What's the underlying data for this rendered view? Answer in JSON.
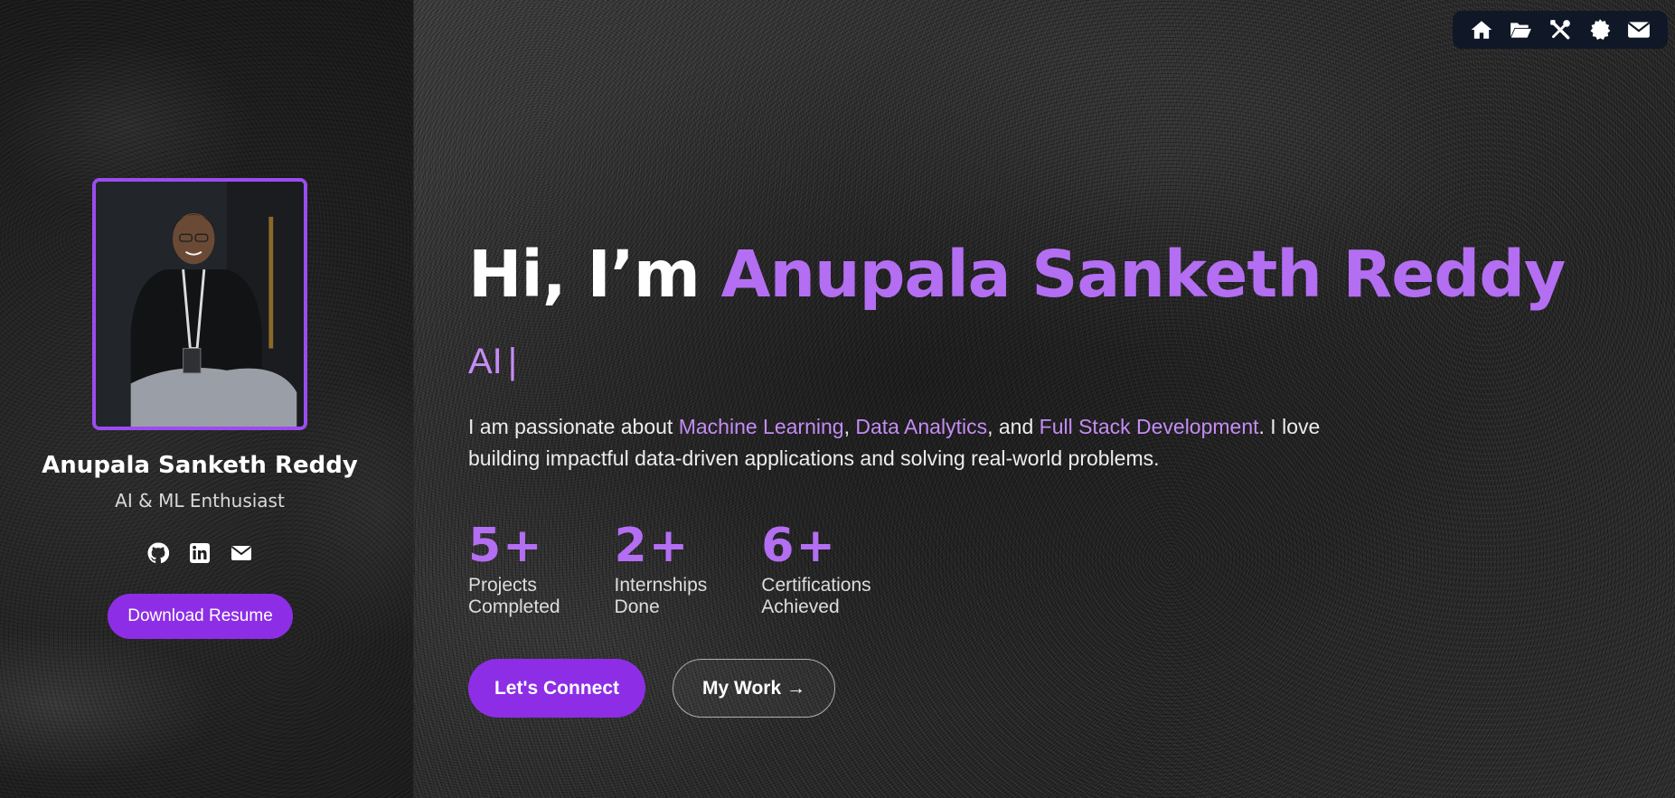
{
  "profile": {
    "name": "Anupala Sanketh Reddy",
    "role": "AI & ML Enthusiast",
    "resume_button": "Download Resume",
    "social": [
      "github-icon",
      "linkedin-icon",
      "mail-icon"
    ]
  },
  "nav": {
    "icons": [
      "home-icon",
      "folder-icon",
      "tools-icon",
      "certificate-icon",
      "mail-icon"
    ]
  },
  "hero": {
    "greeting": "Hi, I’m ",
    "name": "Anupala Sanketh Reddy",
    "typed_text": "AI",
    "typed_cursor": "|",
    "intro_part1": "I am passionate about ",
    "intro_hl1": "Machine Learning",
    "intro_sep1": ", ",
    "intro_hl2": "Data Analytics",
    "intro_sep2": ", and ",
    "intro_hl3": "Full Stack Development",
    "intro_part2": ". I love building impactful data-driven applications and solving real-world problems."
  },
  "stats": [
    {
      "value": "5+",
      "label": "Projects Completed"
    },
    {
      "value": "2+",
      "label": "Internships Done"
    },
    {
      "value": "6+",
      "label": "Certifications Achieved"
    }
  ],
  "actions": {
    "connect": "Let's Connect",
    "work": "My Work →"
  },
  "colors": {
    "accent": "#b36ef2",
    "button": "#8d2ee6",
    "nav_bg": "#101827"
  }
}
